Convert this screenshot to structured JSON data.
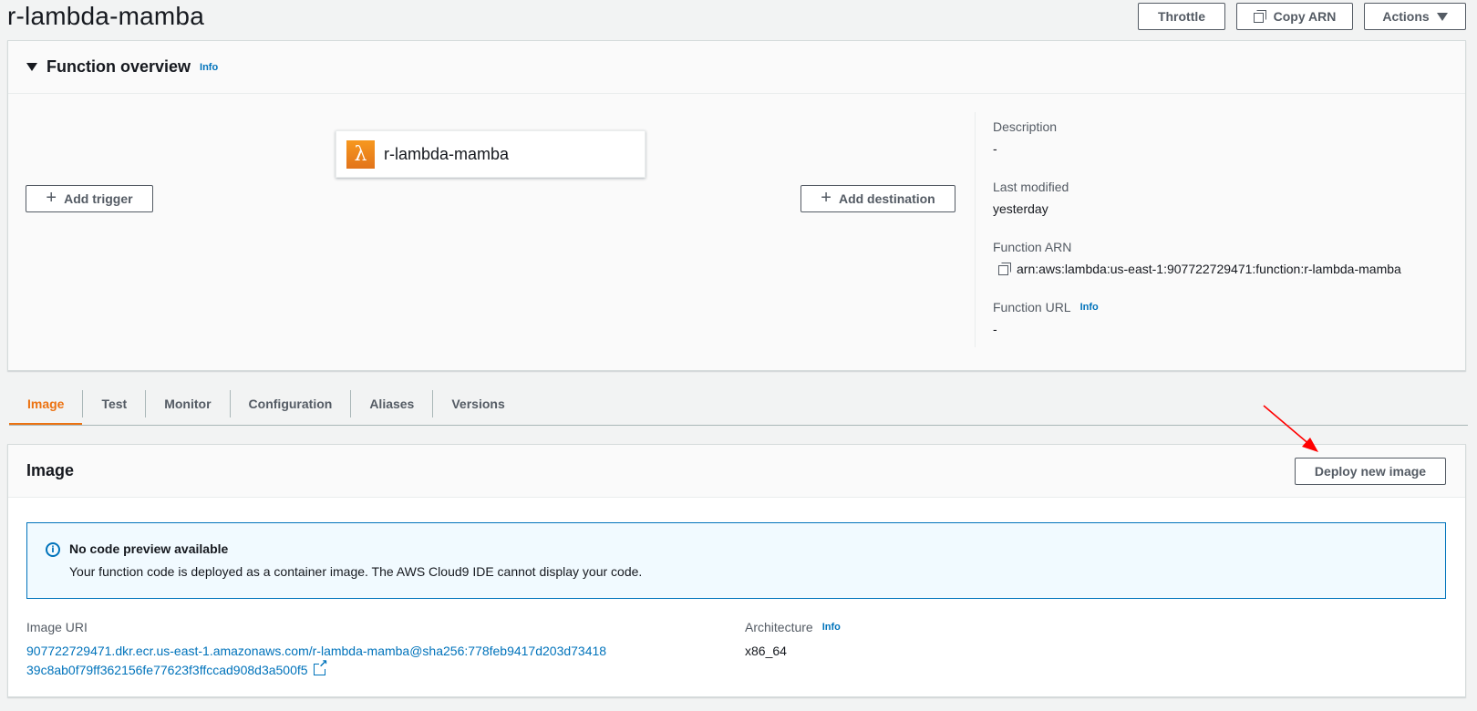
{
  "page": {
    "title": "r-lambda-mamba"
  },
  "header_buttons": {
    "throttle": "Throttle",
    "copy_arn": "Copy ARN",
    "actions": "Actions"
  },
  "overview": {
    "title": "Function overview",
    "info": "Info",
    "function_name": "r-lambda-mamba",
    "add_trigger": "Add trigger",
    "add_destination": "Add destination",
    "description_label": "Description",
    "description_value": "-",
    "last_modified_label": "Last modified",
    "last_modified_value": "yesterday",
    "arn_label": "Function ARN",
    "arn_value": "arn:aws:lambda:us-east-1:907722729471:function:r-lambda-mamba",
    "url_label": "Function URL",
    "url_info": "Info",
    "url_value": "-"
  },
  "tabs": [
    "Image",
    "Test",
    "Monitor",
    "Configuration",
    "Aliases",
    "Versions"
  ],
  "image_panel": {
    "title": "Image",
    "deploy_button": "Deploy new image",
    "alert_title": "No code preview available",
    "alert_body": "Your function code is deployed as a container image. The AWS Cloud9 IDE cannot display your code.",
    "uri_label": "Image URI",
    "uri_value": "907722729471.dkr.ecr.us-east-1.amazonaws.com/r-lambda-mamba@sha256:778feb9417d203d7341839c8ab0f79ff362156fe77623f3ffccad908d3a500f5",
    "arch_label": "Architecture",
    "arch_info": "Info",
    "arch_value": "x86_64"
  },
  "colors": {
    "accent": "#ec7211",
    "link": "#0073bb",
    "annotation_arrow": "#ff0000"
  }
}
